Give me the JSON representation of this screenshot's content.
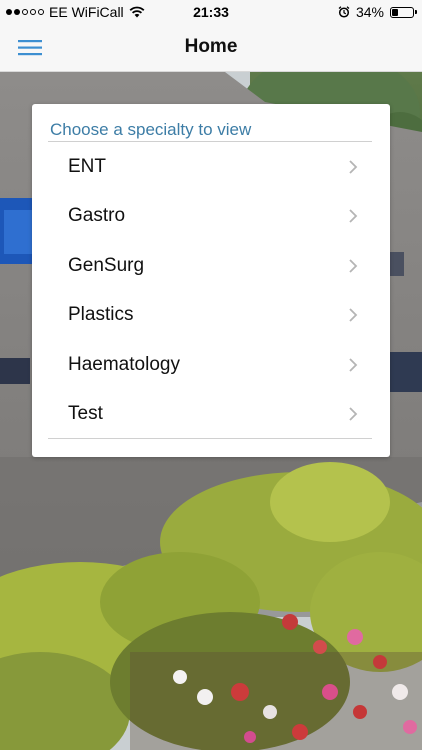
{
  "status_bar": {
    "carrier": "EE WiFiCall",
    "time": "21:33",
    "battery": "34%",
    "battery_level": 0.34,
    "signal_strength": 2,
    "signal_max": 5,
    "icons": [
      "wifi-icon",
      "alarm-clock-icon",
      "battery-icon"
    ]
  },
  "nav": {
    "title": "Home",
    "menu_icon": "hamburger-menu-icon",
    "accent_color": "#3d8fd1"
  },
  "card": {
    "title": "Choose a specialty to view",
    "title_color": "#3d7da6",
    "items": [
      {
        "label": "ENT"
      },
      {
        "label": "Gastro"
      },
      {
        "label": "GenSurg"
      },
      {
        "label": "Plastics"
      },
      {
        "label": "Haematology"
      },
      {
        "label": "Test"
      }
    ],
    "item_icon": "chevron-right-icon"
  }
}
